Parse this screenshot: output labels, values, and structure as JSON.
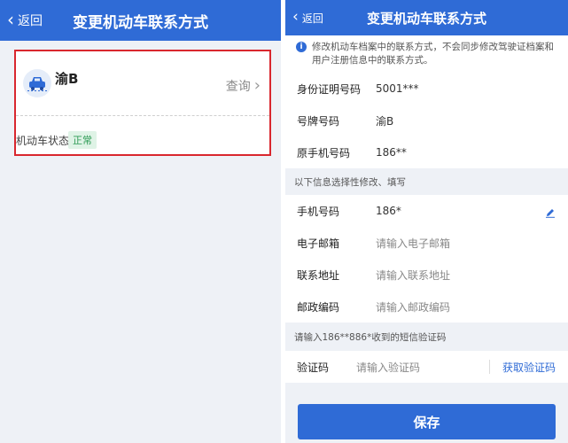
{
  "left": {
    "nav": {
      "back_label": "返回",
      "title": "变更机动车联系方式"
    },
    "vehicle": {
      "plate": "渝B",
      "query_label": "查询",
      "status_label": "机动车状态",
      "status_value": "正常"
    }
  },
  "right": {
    "nav": {
      "back_label": "返回",
      "title": "变更机动车联系方式"
    },
    "notice": "修改机动车档案中的联系方式，不会同步修改驾驶证档案和用户注册信息中的联系方式。",
    "info": [
      {
        "label": "身份证明号码",
        "value": "5001***"
      },
      {
        "label": "号牌号码",
        "value": "渝B"
      },
      {
        "label": "原手机号码",
        "value": "186**"
      }
    ],
    "section_title": "以下信息选择性修改、填写",
    "editable": {
      "phone": {
        "label": "手机号码",
        "value": "186*"
      },
      "email": {
        "label": "电子邮箱",
        "placeholder": "请输入电子邮箱"
      },
      "address": {
        "label": "联系地址",
        "placeholder": "请输入联系地址"
      },
      "postcode": {
        "label": "邮政编码",
        "placeholder": "请输入邮政编码"
      }
    },
    "sms_hint": "请输入186**886*收到的短信验证码",
    "code": {
      "label": "验证码",
      "placeholder": "请输入验证码",
      "get_code_label": "获取验证码"
    },
    "save_label": "保存"
  },
  "colors": {
    "primary": "#2f6bd6",
    "highlight_border": "#d9272e",
    "status_green": "#2e9b55"
  }
}
